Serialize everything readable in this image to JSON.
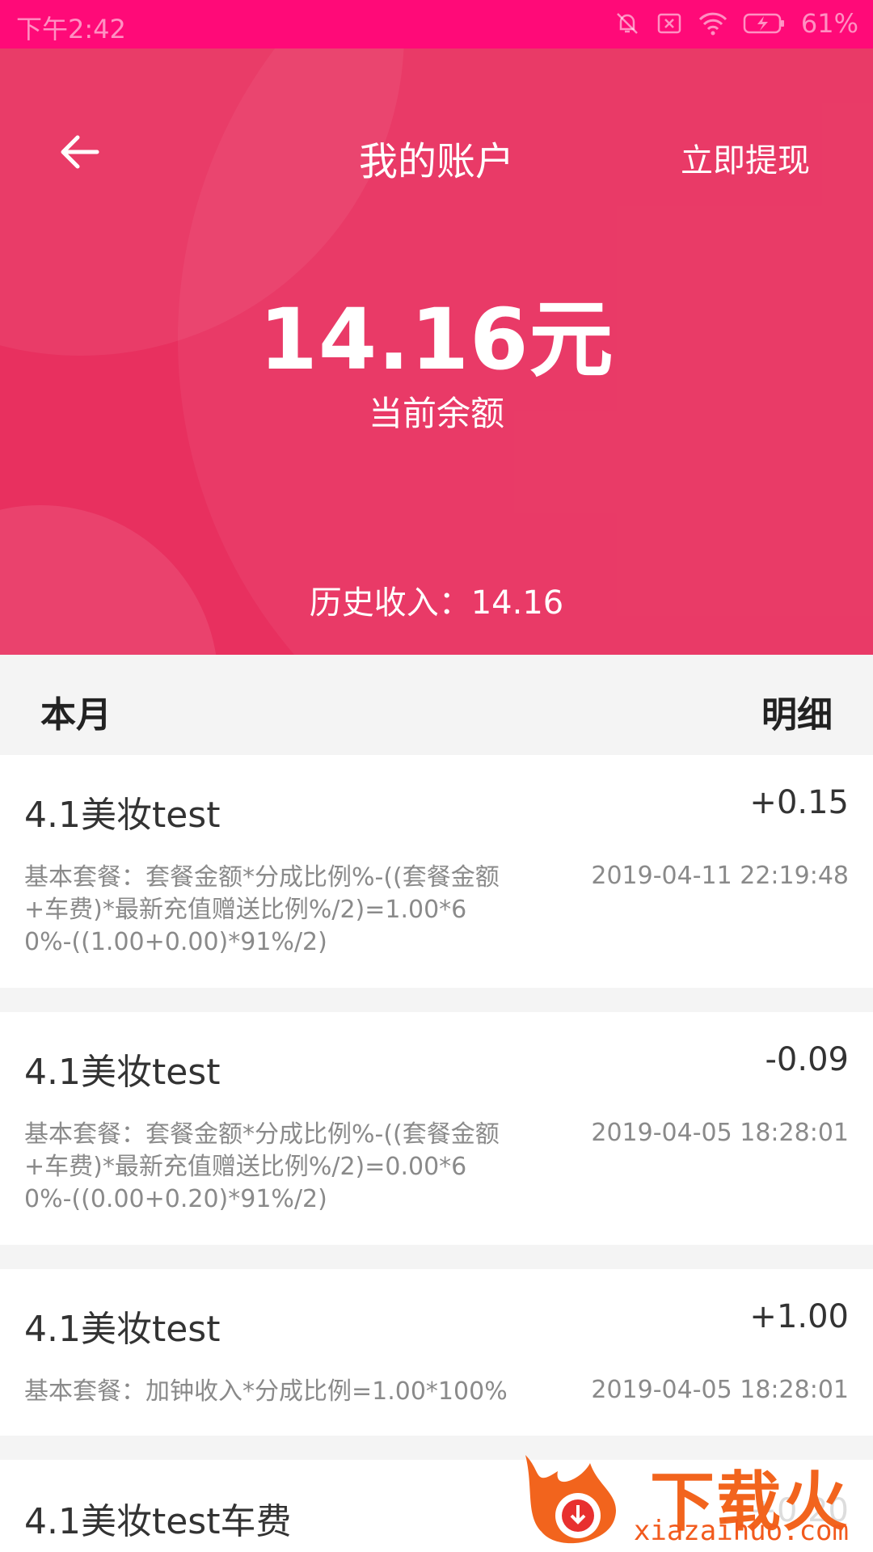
{
  "status_bar": {
    "time": "下午2:42",
    "battery": "61%"
  },
  "header": {
    "title": "我的账户",
    "withdraw_label": "立即提现"
  },
  "balance": {
    "amount": "14.16元",
    "label": "当前余额",
    "history": "历史收入：14.16"
  },
  "section": {
    "month_label": "本月",
    "detail_label": "明细"
  },
  "records": [
    {
      "name": "4.1美妆test",
      "amount": "+0.15",
      "desc": "基本套餐：套餐金额*分成比例%-((套餐金额+车费)*最新充值赠送比例%/2)=1.00*60%-((1.00+0.00)*91%/2)",
      "date": "2019-04-11 22:19:48"
    },
    {
      "name": "4.1美妆test",
      "amount": "-0.09",
      "desc": "基本套餐：套餐金额*分成比例%-((套餐金额+车费)*最新充值赠送比例%/2)=0.00*60%-((0.00+0.20)*91%/2)",
      "date": "2019-04-05 18:28:01"
    },
    {
      "name": "4.1美妆test",
      "amount": "+1.00",
      "desc": "基本套餐：加钟收入*分成比例=1.00*100%",
      "date": "2019-04-05 18:28:01"
    },
    {
      "name": "4.1美妆test车费",
      "amount": "+0.20"
    }
  ],
  "watermark": {
    "title": "下载火",
    "url": "xiazaihuo.com"
  },
  "colors": {
    "status_bar": "#ff0a78",
    "hero": "#e8305f",
    "watermark": "#f2641d"
  }
}
